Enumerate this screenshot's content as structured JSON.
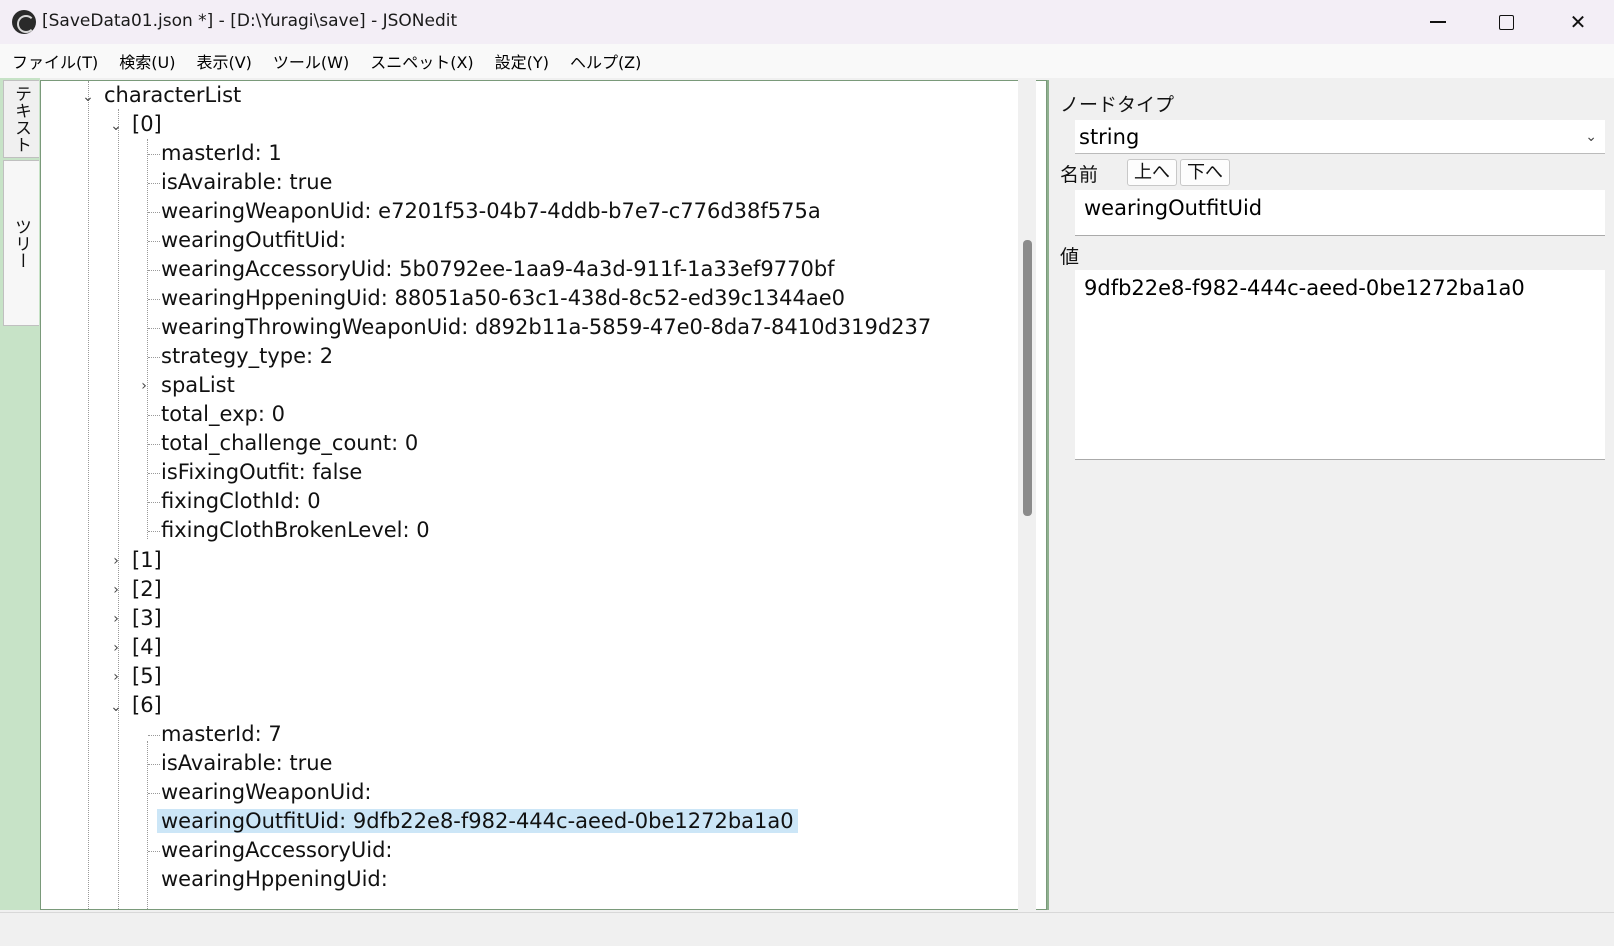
{
  "window": {
    "title": "[SaveData01.json *] - [D:\\Yuragi\\save] - JSONedit"
  },
  "menu": [
    "ファイル(T)",
    "検索(U)",
    "表示(V)",
    "ツール(W)",
    "スニペット(X)",
    "設定(Y)",
    "ヘルプ(Z)"
  ],
  "side_tabs": {
    "text": "テキスト",
    "tree": "ツリー"
  },
  "tree": {
    "root": "characterList",
    "item0": {
      "label": "[0]",
      "children": [
        "masterId: 1",
        "isAvairable: true",
        "wearingWeaponUid: e7201f53-04b7-4ddb-b7e7-c776d38f575a",
        "wearingOutfitUid:",
        "wearingAccessoryUid: 5b0792ee-1aa9-4a3d-911f-1a33ef9770bf",
        "wearingHppeningUid: 88051a50-63c1-438d-8c52-ed39c1344ae0",
        "wearingThrowingWeaponUid: d892b11a-5859-47e0-8da7-8410d319d237",
        "strategy_type: 2",
        "spaList",
        "total_exp: 0",
        "total_challenge_count: 0",
        "isFixingOutfit: false",
        "fixingClothId: 0",
        "fixingClothBrokenLevel: 0"
      ]
    },
    "collapsed": [
      "[1]",
      "[2]",
      "[3]",
      "[4]",
      "[5]"
    ],
    "item6": {
      "label": "[6]",
      "children": [
        "masterId: 7",
        "isAvairable: true",
        "wearingWeaponUid:",
        "wearingOutfitUid: 9dfb22e8-f982-444c-aeed-0be1272ba1a0",
        "wearingAccessoryUid:",
        "wearingHppeningUid:"
      ]
    }
  },
  "props": {
    "node_type_label": "ノードタイプ",
    "node_type_value": "string",
    "name_label": "名前",
    "up_button": "上へ",
    "down_button": "下へ",
    "name_value": "wearingOutfitUid",
    "value_label": "値",
    "value_value": "9dfb22e8-f982-444c-aeed-0be1272ba1a0"
  }
}
